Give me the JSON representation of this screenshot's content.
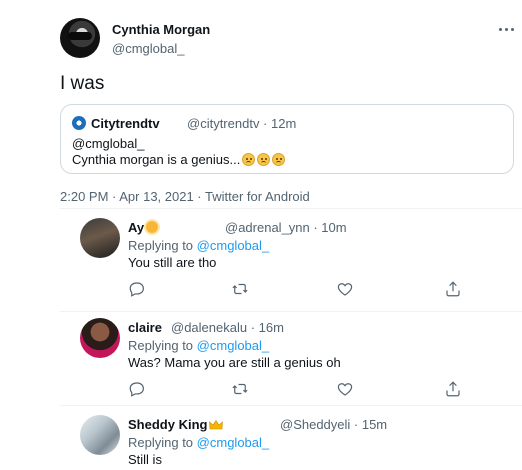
{
  "main_tweet": {
    "display_name": "Cynthia Morgan",
    "handle": "@cmglobal_",
    "text": "I was",
    "meta": "2:20 PM · Apr 13, 2021 · Twitter for Android"
  },
  "quoted_tweet": {
    "display_name": "Citytrendtv",
    "handle_time": "@citytrendtv · 12m",
    "line1": "@cmglobal_",
    "line2": "Cynthia morgan is a genius..."
  },
  "replies": [
    {
      "display_name": "Ay",
      "handle_time": "@adrenal_ynn · 10m",
      "replying_prefix": "Replying to",
      "replying_to": "@cmglobal_",
      "text": "You still are tho"
    },
    {
      "display_name": "claire",
      "handle_time": "@dalenekalu · 16m",
      "replying_prefix": "Replying to",
      "replying_to": "@cmglobal_",
      "text": "Was? Mama you are still a genius oh"
    },
    {
      "display_name": "Sheddy King",
      "handle_time": "@Sheddyeli · 15m",
      "replying_prefix": "Replying to",
      "replying_to": "@cmglobal_",
      "text": "Still is"
    }
  ],
  "icons": {
    "more": "more-horizontal-icon",
    "reply": "reply-icon",
    "retweet": "retweet-icon",
    "like": "heart-icon",
    "share": "share-icon"
  },
  "colors": {
    "accent": "#1d9bf0",
    "secondary_text": "#536471",
    "border": "#cfd9de"
  }
}
